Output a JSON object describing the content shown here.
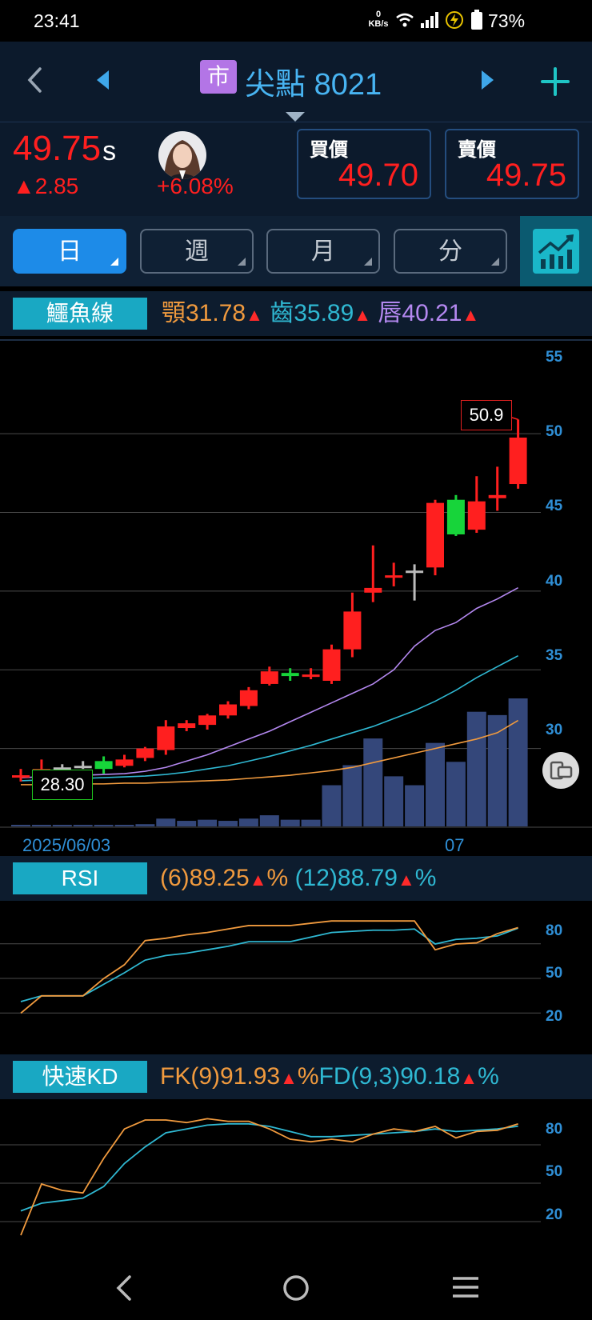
{
  "status": {
    "time": "23:41",
    "net_speed": "0",
    "net_unit": "KB/s",
    "battery": "73%"
  },
  "nav": {
    "market_badge": "市",
    "stock_name": "尖點",
    "stock_code": "8021"
  },
  "quote": {
    "price": "49.75",
    "price_suffix": "s",
    "change": "▲2.85",
    "change_pct": "+6.08%",
    "bid_label": "買價",
    "bid": "49.70",
    "ask_label": "賣價",
    "ask": "49.75",
    "colors": {
      "up": "#ff1f1f",
      "down": "#17d43a"
    }
  },
  "period_tabs": [
    {
      "label": "日",
      "active": true
    },
    {
      "label": "週",
      "active": false
    },
    {
      "label": "月",
      "active": false
    },
    {
      "label": "分",
      "active": false
    }
  ],
  "main_indicator": {
    "label": "鱷魚線",
    "jaw": "顎31.78",
    "teeth": "齒35.89",
    "lips": "唇40.21",
    "colors": {
      "jaw": "#f09a3e",
      "teeth": "#2fb8d2",
      "lips": "#b488f0"
    }
  },
  "price_axis": [
    "55",
    "50",
    "45",
    "40",
    "35",
    "30"
  ],
  "date_labels": {
    "start": "2025/06/03",
    "month": "07"
  },
  "markers": {
    "high": "50.9",
    "low": "28.30"
  },
  "rsi": {
    "label": "RSI",
    "short": "(6)89.25",
    "long": "(12)88.79",
    "unit": "%",
    "axis": [
      "80",
      "50",
      "20"
    ]
  },
  "kd": {
    "label": "快速KD",
    "fk": "FK(9)91.93",
    "fd": "FD(9,3)90.18",
    "unit": "%",
    "axis": [
      "80",
      "50",
      "20"
    ]
  },
  "chart_data": {
    "type": "candlestick",
    "ylim": [
      25,
      56
    ],
    "candles": [
      {
        "o": 28.2,
        "h": 28.7,
        "l": 27.9,
        "c": 28.3
      },
      {
        "o": 28.3,
        "h": 29.3,
        "l": 28.2,
        "c": 28.7
      },
      {
        "o": 28.8,
        "h": 29.0,
        "l": 28.6,
        "c": 28.8
      },
      {
        "o": 28.9,
        "h": 29.2,
        "l": 28.7,
        "c": 28.9
      },
      {
        "o": 29.2,
        "h": 29.5,
        "l": 28.4,
        "c": 28.7
      },
      {
        "o": 28.9,
        "h": 29.6,
        "l": 28.8,
        "c": 29.3
      },
      {
        "o": 29.4,
        "h": 30.1,
        "l": 29.2,
        "c": 30.0
      },
      {
        "o": 29.9,
        "h": 31.8,
        "l": 29.6,
        "c": 31.4
      },
      {
        "o": 31.3,
        "h": 31.8,
        "l": 31.1,
        "c": 31.6
      },
      {
        "o": 31.5,
        "h": 32.2,
        "l": 31.2,
        "c": 32.1
      },
      {
        "o": 32.1,
        "h": 33.0,
        "l": 31.9,
        "c": 32.8
      },
      {
        "o": 32.7,
        "h": 33.9,
        "l": 32.5,
        "c": 33.7
      },
      {
        "o": 34.1,
        "h": 35.2,
        "l": 34.0,
        "c": 34.9
      },
      {
        "o": 34.8,
        "h": 35.1,
        "l": 34.3,
        "c": 34.6
      },
      {
        "o": 34.6,
        "h": 35.1,
        "l": 34.4,
        "c": 34.7
      },
      {
        "o": 34.3,
        "h": 36.6,
        "l": 34.1,
        "c": 36.3
      },
      {
        "o": 36.3,
        "h": 39.9,
        "l": 35.8,
        "c": 38.7
      },
      {
        "o": 39.9,
        "h": 42.9,
        "l": 39.3,
        "c": 40.2
      },
      {
        "o": 40.9,
        "h": 41.8,
        "l": 40.3,
        "c": 41.0
      },
      {
        "o": 41.3,
        "h": 41.7,
        "l": 39.4,
        "c": 41.3
      },
      {
        "o": 41.5,
        "h": 45.8,
        "l": 41.0,
        "c": 45.6
      },
      {
        "o": 45.8,
        "h": 46.1,
        "l": 43.5,
        "c": 43.6
      },
      {
        "o": 43.9,
        "h": 47.3,
        "l": 43.7,
        "c": 45.7
      },
      {
        "o": 45.9,
        "h": 47.9,
        "l": 45.1,
        "c": 46.1
      },
      {
        "o": 46.8,
        "h": 50.9,
        "l": 46.5,
        "c": 49.75
      }
    ],
    "volume_rel": [
      0.01,
      0.01,
      0.01,
      0.01,
      0.01,
      0.01,
      0.02,
      0.07,
      0.05,
      0.06,
      0.05,
      0.07,
      0.1,
      0.06,
      0.06,
      0.37,
      0.55,
      0.79,
      0.45,
      0.37,
      0.75,
      0.58,
      1.03,
      1.0,
      1.15
    ],
    "alligator": {
      "jaw": [
        27.7,
        27.7,
        27.7,
        27.75,
        27.75,
        27.8,
        27.8,
        27.85,
        27.9,
        27.95,
        28.0,
        28.1,
        28.2,
        28.3,
        28.45,
        28.6,
        28.8,
        29.1,
        29.4,
        29.7,
        30.0,
        30.3,
        30.6,
        31.0,
        31.78
      ],
      "teeth": [
        27.95,
        28.0,
        28.05,
        28.1,
        28.15,
        28.2,
        28.25,
        28.35,
        28.5,
        28.7,
        28.9,
        29.2,
        29.5,
        29.85,
        30.2,
        30.6,
        31.0,
        31.4,
        31.9,
        32.4,
        33.0,
        33.7,
        34.5,
        35.2,
        35.89
      ],
      "lips": [
        28.15,
        28.2,
        28.25,
        28.3,
        28.35,
        28.4,
        28.55,
        28.8,
        29.2,
        29.6,
        30.1,
        30.6,
        31.1,
        31.7,
        32.3,
        32.9,
        33.5,
        34.1,
        35.0,
        36.5,
        37.5,
        38.0,
        38.9,
        39.5,
        40.21
      ]
    },
    "rsi6": [
      15,
      30,
      30,
      30,
      45,
      57,
      78,
      80,
      83,
      85,
      88,
      91,
      91,
      91,
      93,
      95,
      95,
      95,
      95,
      95,
      70,
      75,
      76,
      84,
      89.25
    ],
    "rsi12": [
      25,
      30,
      30,
      30,
      40,
      50,
      61,
      65,
      67,
      70,
      73,
      77,
      77,
      77,
      81,
      85,
      86,
      87,
      87,
      88,
      75,
      79,
      80,
      82,
      88.79
    ],
    "fk": [
      5,
      45,
      40,
      38,
      65,
      88,
      95,
      95,
      93,
      96,
      94,
      94,
      88,
      80,
      78,
      80,
      78,
      84,
      88,
      86,
      90,
      81,
      86,
      87,
      91.93
    ],
    "fd": [
      24,
      30,
      32,
      34,
      43,
      61,
      74,
      85,
      88,
      91,
      92,
      92,
      90,
      86,
      82,
      82,
      83,
      84,
      85,
      86,
      88,
      86,
      87,
      88,
      90.18
    ]
  }
}
